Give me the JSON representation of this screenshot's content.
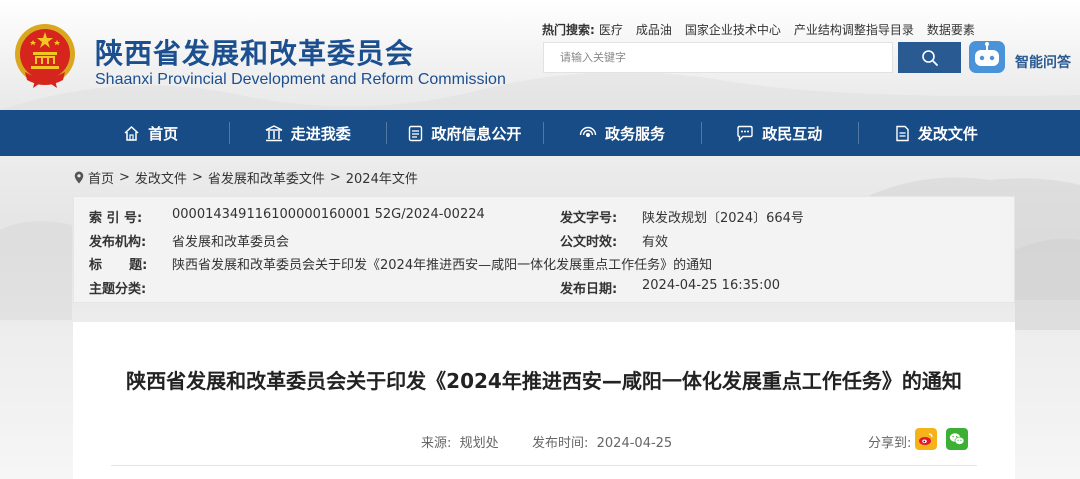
{
  "site": {
    "title_cn": "陕西省发展和改革委员会",
    "title_en": "Shaanxi Provincial Development and Reform Commission"
  },
  "hot_search": {
    "label": "热门搜索:",
    "items": [
      "医疗",
      "成品油",
      "国家企业技术中心",
      "产业结构调整指导目录",
      "数据要素"
    ]
  },
  "search": {
    "placeholder": "请输入关键字",
    "value": ""
  },
  "ai": {
    "label": "智能问答"
  },
  "nav": {
    "items": [
      {
        "label": "首页",
        "icon": "home-icon"
      },
      {
        "label": "走进我委",
        "icon": "building-icon"
      },
      {
        "label": "政府信息公开",
        "icon": "document-icon"
      },
      {
        "label": "政务服务",
        "icon": "service-icon"
      },
      {
        "label": "政民互动",
        "icon": "chat-icon"
      },
      {
        "label": "发改文件",
        "icon": "file-icon"
      }
    ]
  },
  "breadcrumb": {
    "items": [
      "首页",
      "发改文件",
      "省发展和改革委文件",
      "2024年文件"
    ],
    "separator": ">"
  },
  "meta": {
    "index_label": "索 引 号:",
    "index_value": "000014349116100000160001 52G/2024-00224",
    "doc_no_label": "发文字号:",
    "doc_no_value": "陕发改规划〔2024〕664号",
    "org_label": "发布机构:",
    "org_value": "省发展和改革委员会",
    "validity_label": "公文时效:",
    "validity_value": "有效",
    "subject_label": "标      题:",
    "subject_value": "陕西省发展和改革委员会关于印发《2024年推进西安—咸阳一体化发展重点工作任务》的通知",
    "category_label": "主题分类:",
    "category_value": "",
    "date_label": "发布日期:",
    "date_value": "2024-04-25 16:35:00"
  },
  "article": {
    "title": "陕西省发展和改革委员会关于印发《2024年推进西安—咸阳一体化发展重点工作任务》的通知",
    "source": "来源:  规划处",
    "date": "发布时间:  2024-04-25",
    "share_label": "分享到:"
  },
  "colors": {
    "nav_bg": "#184c86",
    "brand_blue": "#1c4f8f",
    "search_btn": "#2a5a92",
    "weibo": "#f6b219",
    "wechat": "#3cb034"
  }
}
